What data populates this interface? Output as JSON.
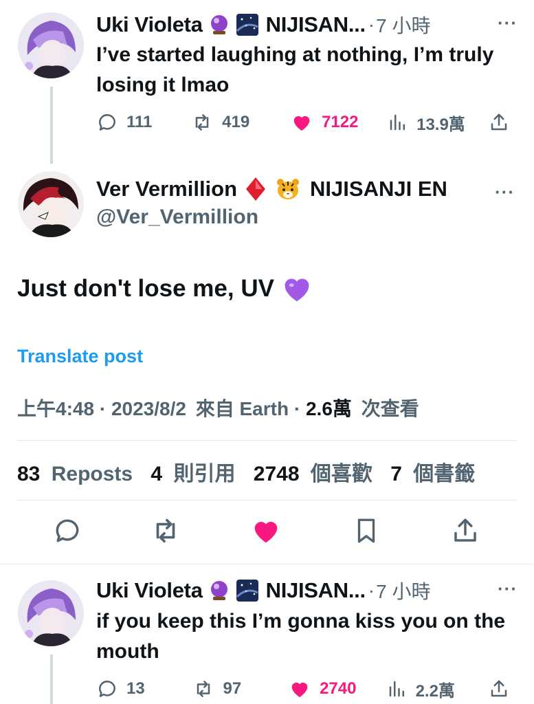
{
  "tweet1": {
    "author_name": "Uki Violeta",
    "affiliation": "NIJISAN...",
    "separator": "·",
    "time": "7 小時",
    "text": "I’ve started laughing at nothing, I’m truly losing it lmao",
    "replies": "111",
    "reposts": "419",
    "likes": "7122",
    "views": "13.9萬"
  },
  "main": {
    "author_name": "Ver Vermillion",
    "affiliation": "NIJISANJI EN",
    "handle": "@Ver_Vermillion",
    "text": "Just don't lose me, UV",
    "translate": "Translate post",
    "time": "上午4:48",
    "date": "2023/8/2",
    "via": "來自 Earth",
    "views_count": "2.6萬",
    "views_label": "次查看",
    "stats": {
      "reposts_count": "83",
      "reposts_label": "Reposts",
      "quotes_count": "4",
      "quotes_label": "則引用",
      "likes_count": "2748",
      "likes_label": "個喜歡",
      "bookmarks_count": "7",
      "bookmarks_label": "個書籤"
    }
  },
  "tweet3": {
    "author_name": "Uki Violeta",
    "affiliation": "NIJISAN...",
    "separator": "·",
    "time": "7 小時",
    "text": "if you keep this I’m gonna kiss you on the mouth",
    "replies": "13",
    "reposts": "97",
    "likes": "2740",
    "views": "2.2萬"
  },
  "icons": {
    "reply": "speech-bubble",
    "repost": "repost-arrows",
    "like": "heart-filled",
    "views": "bar-chart",
    "share": "share-arrow",
    "bookmark": "bookmark",
    "more": "ellipsis"
  },
  "colors": {
    "like": "#f91880",
    "link": "#1d9bf0",
    "secondary_text": "#536471",
    "primary_text": "#0f1419"
  }
}
